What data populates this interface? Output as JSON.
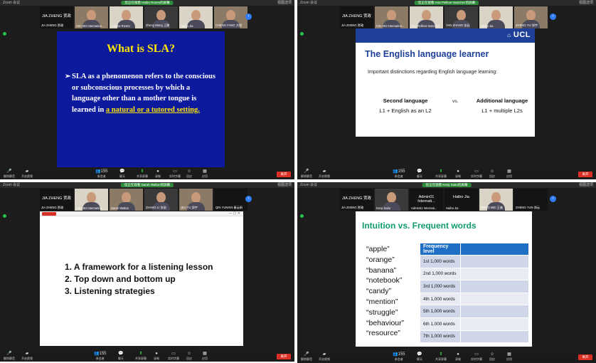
{
  "colors": {
    "zoom_bg": "#1c1c1c",
    "share_green": "#2e8b3a",
    "leave_red": "#d93025",
    "ucl_blue": "#1e3f9a",
    "sla_blue": "#0d1a9e",
    "sla_yellow": "#ffe600",
    "slide4_green": "#0d9b6e",
    "table_blue": "#1f6fc6"
  },
  "panels": [
    {
      "title": "Zoom 会议",
      "share": "您正在观看 Haibo Rones的屏幕",
      "view": "视图选项",
      "participants": [
        "JIA ZHENG 贾政",
        "CIE HEI Internation...",
        "Andrea Rivero",
        "Zheng Wang 王鹏",
        "Haibo Jia",
        "CHENG FANG 方程"
      ],
      "slide": {
        "title": "What is SLA?",
        "bullet_mark": "➢",
        "bullet_text": "SLA as a phenomenon refers to the conscious or subconscious processes by which a language other than a mother tongue is learned in",
        "highlight": "a natural or a tutored setting."
      }
    },
    {
      "title": "Zoom 会议",
      "share": "您正在观看 Ana Pellicer-Sanchez的屏幕",
      "view": "视图选项",
      "participants": [
        "JIA ZHENG 贾政",
        "CIE HEI Internation...",
        "Ana Pellicer-Sanchez",
        "YAN ZHANG 张岩",
        "Haibo Jia",
        "ZHENG YU 郑宇"
      ],
      "slide": {
        "logo": "UCL",
        "title": "The English language learner",
        "subtitle": "Important distinctions regarding English language learning:",
        "col1_head": "Second language",
        "col1_body": "L1 + English as an L2",
        "vs": "vs.",
        "col2_head": "Additional language",
        "col2_body": "L1 + multiple L2s"
      }
    },
    {
      "title": "Zoom 会议",
      "share": "您正在观看 Sarah Walton的屏幕",
      "view": "视图选项",
      "participants": [
        "JIA ZHENG 贾政",
        "CIE HEI Internation...",
        "Sarah Walton",
        "ZHANG LI 张丽",
        "QIU YU 邱宇",
        "QIN YUNXIN 秦云昕"
      ],
      "slide": {
        "items": [
          "1.  A framework for a listening lesson",
          "2.  Top down and bottom up",
          "3.  Listening strategies"
        ]
      }
    },
    {
      "title": "Zoom 会议",
      "share": "您正在观看 Kenji Saito的屏幕",
      "view": "视图选项",
      "participants": [
        "JIA ZHENG 贾政",
        "Kenji Saito",
        "Admin01 Internati...",
        "Haibo Jia",
        "WANG MEI 王美",
        "ZHENG YUN 郑云"
      ],
      "slide": {
        "title": "Intuition vs. Frequent words",
        "words": [
          "“apple”",
          "“orange”",
          "“banana”",
          "“notebook”",
          "“candy”",
          "“mention”",
          "“struggle”",
          "“behaviour”",
          "“resource”"
        ],
        "table_header": "Frequency level",
        "rows": [
          "1st 1,000 words",
          "2nd 1,000 words",
          "3rd 1,000 words",
          "4th 1,000 words",
          "5th 1,000 words",
          "6th 1,000 words",
          "7th 1,000 words"
        ]
      }
    }
  ],
  "toolbar": {
    "mute": "解除静音",
    "video": "开启视频",
    "participants": "参会者",
    "participant_count": "155",
    "chat": "聊天",
    "share": "共享屏幕",
    "record": "录制",
    "captions": "实时字幕",
    "reactions": "回应",
    "apps": "应用",
    "leave": "离开"
  }
}
